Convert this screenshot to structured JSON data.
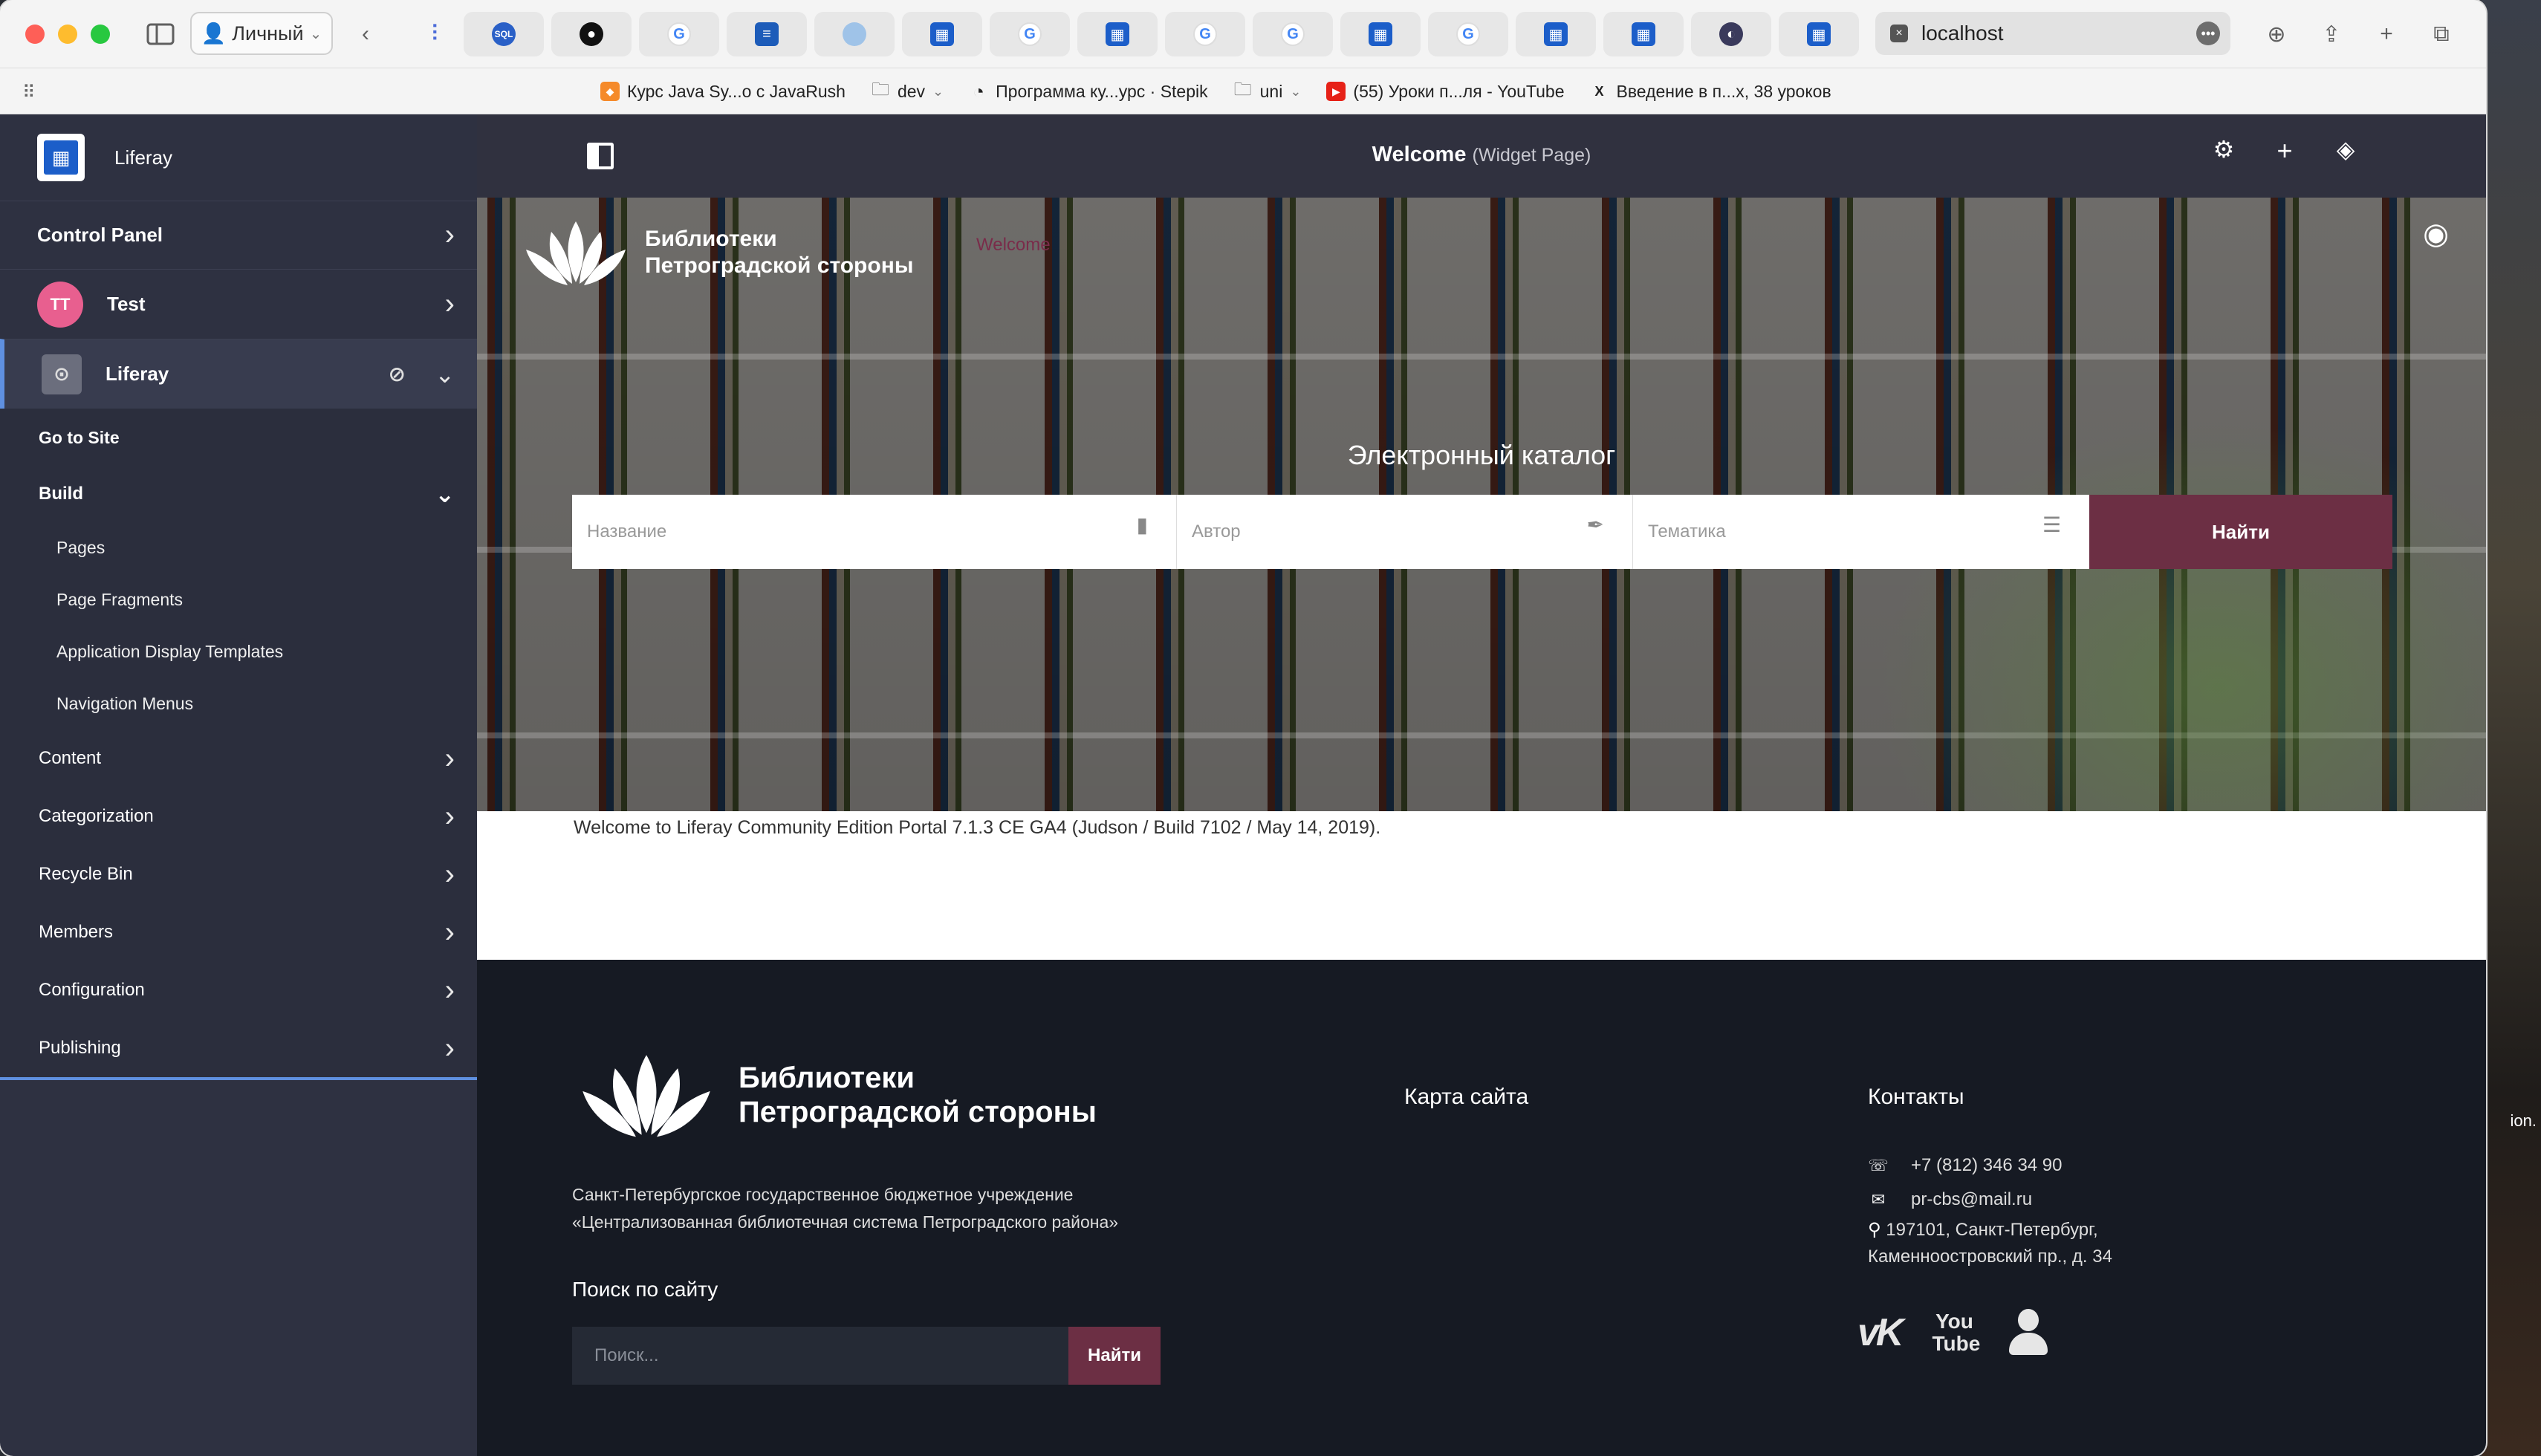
{
  "browser": {
    "profile_label": "Личный",
    "url": "localhost"
  },
  "bookmarks": [
    {
      "label": "Курс Java Sy...о с JavaRush",
      "icon": "javarush-icon",
      "color": "#f58a2a"
    },
    {
      "label": "dev",
      "icon": "folder-icon",
      "color": "#666666"
    },
    {
      "label": "Программа ку...урс · Stepik",
      "icon": "stepik-icon",
      "color": "#222222"
    },
    {
      "label": "uni",
      "icon": "folder-icon",
      "color": "#666666"
    },
    {
      "label": "(55) Уроки п...ля - YouTube",
      "icon": "youtube-icon",
      "color": "#e62117"
    },
    {
      "label": "Введение в п...х, 38 уроков",
      "icon": "x-icon",
      "color": "#222222"
    }
  ],
  "sidebar": {
    "title": "Liferay",
    "control_panel": "Control Panel",
    "user_initials": "TT",
    "user_name": "Test",
    "site_name": "Liferay",
    "go_to_site": "Go to Site",
    "build": "Build",
    "build_items": [
      "Pages",
      "Page Fragments",
      "Application Display Templates",
      "Navigation Menus"
    ],
    "categories": [
      "Content",
      "Categorization",
      "Recycle Bin",
      "Members",
      "Configuration",
      "Publishing"
    ]
  },
  "control_menu": {
    "title": "Welcome",
    "subtitle": "(Widget Page)"
  },
  "hero": {
    "logo_line1": "Библиотеки",
    "logo_line2": "Петроградской стороны",
    "ghost_title": "Welcome",
    "catalog_title": "Электронный каталог",
    "title_placeholder": "Название",
    "author_placeholder": "Автор",
    "topic_placeholder": "Тематика",
    "search_button": "Найти"
  },
  "content": {
    "welcome_message": "Welcome to Liferay Community Edition Portal 7.1.3 CE GA4 (Judson / Build 7102 / May 14, 2019)."
  },
  "footer": {
    "logo_line1": "Библиотеки",
    "logo_line2": "Петроградской стороны",
    "desc_line1": "Санкт-Петербургское государственное бюджетное учреждение",
    "desc_line2": "«Централизованная библиотечная система Петроградского района»",
    "search_title": "Поиск по сайту",
    "search_placeholder": "Поиск...",
    "search_button": "Найти",
    "sitemap_title": "Карта сайта",
    "contacts_title": "Контакты",
    "phone": "+7 (812) 346 34 90",
    "email": "pr-cbs@mail.ru",
    "address_line1": "197101, Санкт-Петербург,",
    "address_line2": "Каменноостровский пр., д. 34"
  },
  "desktop": {
    "partial_text": "ion."
  },
  "colors": {
    "sidebar_bg": "#2e3141",
    "accent_blue": "#5f90e0",
    "button_wine": "#6c2f44",
    "footer_bg": "#161a23"
  }
}
